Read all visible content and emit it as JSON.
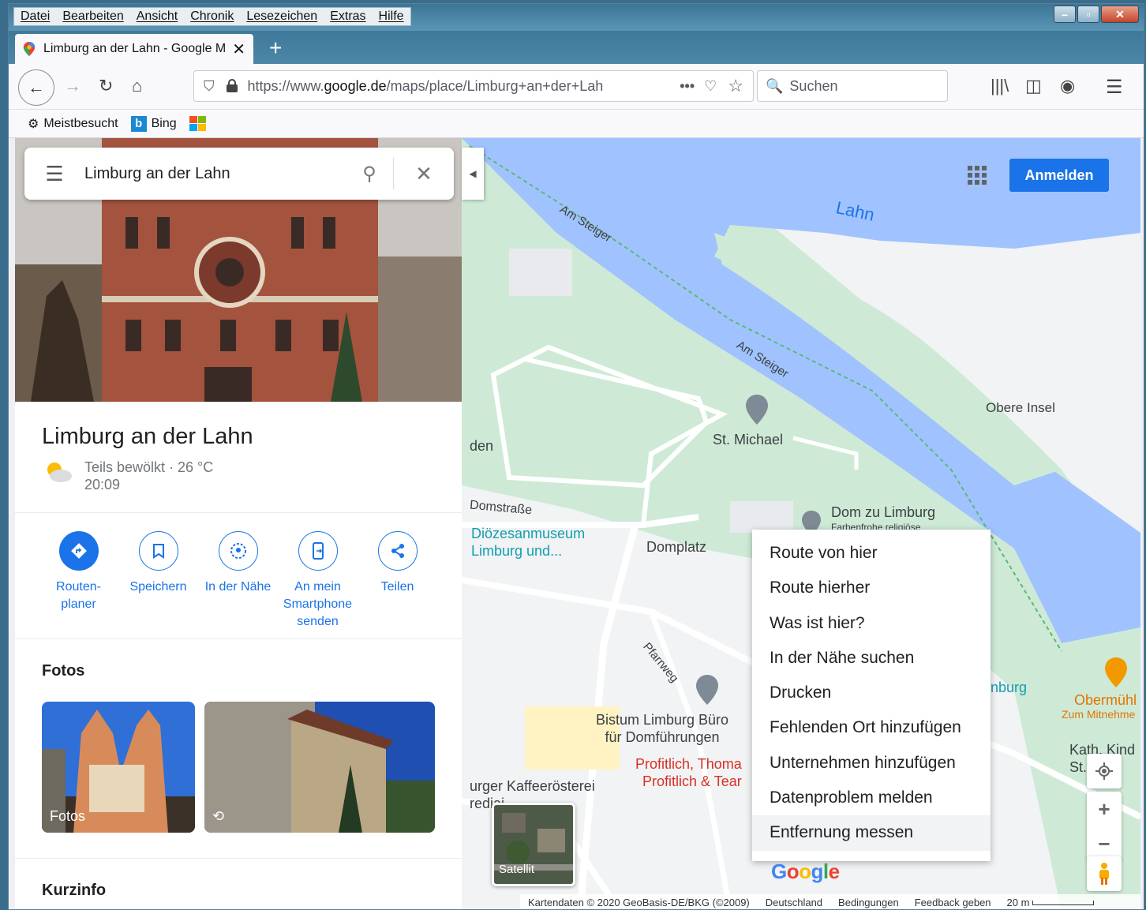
{
  "menubar": {
    "items": [
      "Datei",
      "Bearbeiten",
      "Ansicht",
      "Chronik",
      "Lesezeichen",
      "Extras",
      "Hilfe"
    ]
  },
  "tab": {
    "title": "Limburg an der Lahn - Google M"
  },
  "navbar": {
    "url_prefix": "https://www.",
    "url_host": "google.de",
    "url_path": "/maps/place/Limburg+an+der+Lah",
    "search_placeholder": "Suchen"
  },
  "bookmarks": {
    "items": [
      "Meistbesucht",
      "Bing"
    ]
  },
  "maps": {
    "search_query": "Limburg an der Lahn",
    "place_title": "Limburg an der Lahn",
    "weather": {
      "condition": "Teils bewölkt · 26 °C",
      "time": "20:09"
    },
    "actions": [
      {
        "label": "Routen-\nplaner"
      },
      {
        "label": "Speichern"
      },
      {
        "label": "In der Nähe"
      },
      {
        "label": "An mein Smartphone senden"
      },
      {
        "label": "Teilen"
      }
    ],
    "sections": {
      "photos": "Fotos",
      "info": "Kurzinfo"
    },
    "photo_caption": "Fotos",
    "signin": "Anmelden",
    "satellite": "Satellit",
    "google_logo": "Google",
    "map_labels": {
      "river": "Lahn",
      "street1": "Am Steiger",
      "street2": "Am Steiger",
      "island": "Obere Insel",
      "church1": "St. Michael",
      "dom": "Dom zu Limburg",
      "dom_sub": "Farbenfrohe religiöse",
      "domstrasse": "Domstraße",
      "museum": "Diözesanmuseum\nLimburg und...",
      "domplatz": "Domplatz",
      "pfarrweg": "Pfarrweg",
      "bistum": "Bistum Limburg Büro\nfür Domführungen",
      "profitlich": "Profitlich, Thoma\nProfitlich & Tear",
      "kaffee": "urger Kaffeerösterei\nrediai",
      "burg": "nburg",
      "obermuehl": "Obermühl",
      "mitnehme": "Zum Mitnehme",
      "kath": "Kath. Kind\nSt.",
      "den": "den"
    },
    "context_menu": [
      "Route von hier",
      "Route hierher",
      "Was ist hier?",
      "In der Nähe suchen",
      "Drucken",
      "Fehlenden Ort hinzufügen",
      "Unternehmen hinzufügen",
      "Datenproblem melden",
      "Entfernung messen"
    ],
    "footer": {
      "data": "Kartendaten © 2020 GeoBasis-DE/BKG (©2009)",
      "country": "Deutschland",
      "terms": "Bedingungen",
      "feedback": "Feedback geben",
      "scale": "20 m"
    }
  },
  "colors": {
    "accent": "#1a73e8",
    "water": "#a0c3ff",
    "park": "#ceead6",
    "land": "#f1f3f4"
  }
}
